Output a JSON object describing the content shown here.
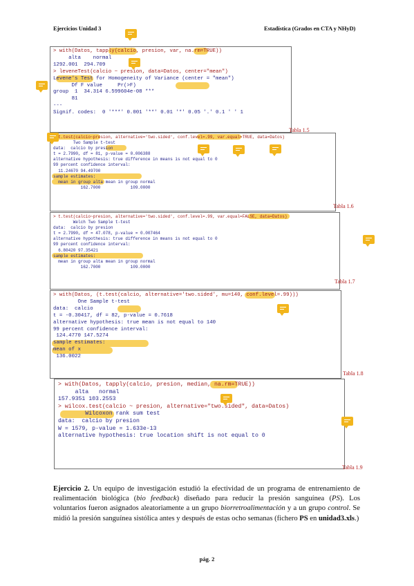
{
  "header": {
    "left": "Ejercicios Unidad 3",
    "right": "Estadística (Grados en CTA y NHyD)"
  },
  "block1": {
    "lines": [
      "> with(Datos, tapply(calcio, presion, var, na.rm=TRUE))",
      "     alta    normal",
      "1292.001  294.709",
      "",
      "> leveneTest(calcio ~ presion, data=Datos, center=\"mean\")",
      "Levene's Test for Homogeneity of Variance (center = \"mean\")",
      "      Df F value     Pr(>F)",
      "group  1  34.314 6.599604e-08 ***",
      "      81",
      "---",
      "Signif. codes:  0 '***' 0.001 '**' 0.01 '*' 0.05 '.' 0.1 ' ' 1"
    ]
  },
  "block2": {
    "lines": [
      "> t.test(calcio~presion, alternative='two.sided', conf.level=.99, var.equal=TRUE, data=Datos)",
      "",
      "        Two Sample t-test",
      "",
      "data:  calcio by presion",
      "t = 2.7990, df = 81, p-value = 0.006388",
      "alternative hypothesis: true difference in means is not equal to 0",
      "99 percent confidence interval:",
      "  11.24670 94.49700",
      "sample estimates:",
      "  mean in group alta mean in group normal",
      "           162.7000            109.0000"
    ]
  },
  "block3": {
    "lines": [
      "> t.test(calcio~presion, alternative='two.sided', conf.level=.99, var.equal=FALSE, data=Datos)",
      "",
      "        Welch Two Sample t-test",
      "",
      "data:  calcio by presion",
      "t = 2.7990, df = 47.078, p-value = 0.007464",
      "alternative hypothesis: true difference in means is not equal to 0",
      "99 percent confidence interval:",
      "  6.80420 97.35421",
      "sample estimates:",
      "  mean in group alta mean in group normal",
      "           162.7000            109.0000"
    ]
  },
  "block4": {
    "lines": [
      "> with(Datos, (t.test(calcio, alternative='two.sided', mu=140, conf.level=.99)))",
      "",
      "        One Sample t-test",
      "",
      "data:  calcio",
      "t = -0.30417, df = 82, p-value = 0.7618",
      "alternative hypothesis: true mean is not equal to 140",
      "99 percent confidence interval:",
      " 124.4770 147.5274",
      "sample estimates:",
      "mean of x",
      " 136.0022"
    ]
  },
  "block5": {
    "lines": [
      "> with(Datos, tapply(calcio, presion, median, na.rm=TRUE))",
      "     alta   normal",
      "157.9351 103.2553",
      "",
      "> wilcox.test(calcio ~ presion, alternative=\"two.sided\", data=Datos)",
      "",
      "        Wilcoxon rank sum test",
      "",
      "data:  calcio by presion",
      "W = 1579, p-value = 1.633e-13",
      "alternative hypothesis: true location shift is not equal to 0"
    ]
  },
  "tables": {
    "t15": "Tabla 1.5",
    "t16": "Tabla 1.6",
    "t17": "Tabla 1.7",
    "t18": "Tabla 1.8",
    "t19": "Tabla 1.9"
  },
  "exercise": {
    "title": "Ejercicio 2.",
    "p1": " Un equipo de investigación estudió la efectividad de un programa de entrenamiento de realimentación biológica (",
    "em1": "bio feedback",
    "p2": ") diseñado para reducir la presión sanguínea (",
    "em2": "PS",
    "p3": "). Los voluntarios fueron asignados aleatoriamente a un grupo ",
    "em3": "biorretroalimentación",
    "p4": " y a un grupo ",
    "em4": "control",
    "p5": ". Se midió la presión sanguínea sistólica antes y después de estas ocho semanas (fichero ",
    "b1": "PS",
    "p6": " en ",
    "b2": "unidad3.xls",
    "p7": ".)"
  },
  "footer": "pág. 2",
  "colors": {
    "code": "#24248a",
    "highlight": "#f6c32f",
    "note": "#f2b51c",
    "table_label": "#b11a1a"
  },
  "icons": [
    "comment-note-icon"
  ]
}
